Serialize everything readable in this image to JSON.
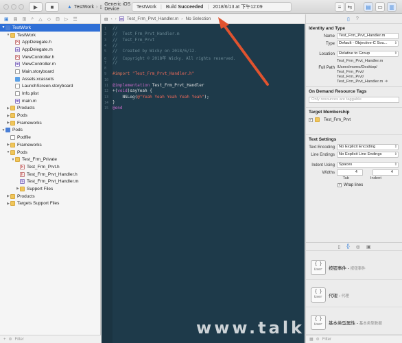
{
  "toolbar": {
    "scheme_label": "TestWork",
    "device_label": "Generic iOS Device",
    "status": {
      "project": "TestWork",
      "build_prefix": "Build",
      "build_result": "Succeeded",
      "timestamp": "2018/6/13 at 下午12:09"
    }
  },
  "navigator": {
    "filter_placeholder": "Filter",
    "items": [
      {
        "label": "TestWork",
        "kind": "proj",
        "depth": 0,
        "expanded": true,
        "selected": true
      },
      {
        "label": "TestWork",
        "kind": "folder",
        "depth": 1,
        "expanded": true
      },
      {
        "label": "AppDelegate.h",
        "kind": "h",
        "depth": 2
      },
      {
        "label": "AppDelegate.m",
        "kind": "m",
        "depth": 2
      },
      {
        "label": "ViewController.h",
        "kind": "h",
        "depth": 2
      },
      {
        "label": "ViewController.m",
        "kind": "m",
        "depth": 2
      },
      {
        "label": "Main.storyboard",
        "kind": "sb",
        "depth": 2
      },
      {
        "label": "Assets.xcassets",
        "kind": "xc",
        "depth": 2
      },
      {
        "label": "LaunchScreen.storyboard",
        "kind": "sb",
        "depth": 2
      },
      {
        "label": "Info.plist",
        "kind": "plist",
        "depth": 2
      },
      {
        "label": "main.m",
        "kind": "m",
        "depth": 2
      },
      {
        "label": "Products",
        "kind": "folder",
        "depth": 1,
        "expanded": false
      },
      {
        "label": "Pods",
        "kind": "folder",
        "depth": 1,
        "expanded": false
      },
      {
        "label": "Frameworks",
        "kind": "folder",
        "depth": 1,
        "expanded": false
      },
      {
        "label": "Pods",
        "kind": "proj",
        "depth": 0,
        "expanded": true
      },
      {
        "label": "Podfile",
        "kind": "plist",
        "depth": 1
      },
      {
        "label": "Frameworks",
        "kind": "folder",
        "depth": 1,
        "expanded": false
      },
      {
        "label": "Pods",
        "kind": "folder",
        "depth": 1,
        "expanded": true
      },
      {
        "label": "Test_Frm_Private",
        "kind": "folder",
        "depth": 2,
        "expanded": true
      },
      {
        "label": "Test_Frm_Prvt.h",
        "kind": "h",
        "depth": 3
      },
      {
        "label": "Test_Frm_Prvt_Handler.h",
        "kind": "h",
        "depth": 3
      },
      {
        "label": "Test_Frm_Prvt_Handler.m",
        "kind": "m",
        "depth": 3
      },
      {
        "label": "Support Files",
        "kind": "folder",
        "depth": 3,
        "expanded": false
      },
      {
        "label": "Products",
        "kind": "folder",
        "depth": 1,
        "expanded": false
      },
      {
        "label": "Targets Support Files",
        "kind": "folder",
        "depth": 1,
        "expanded": false
      }
    ]
  },
  "editor": {
    "jumpbar_file": "Test_Frm_Prvt_Handler.m",
    "jumpbar_selection": "No Selection",
    "lines": [
      {
        "n": "1",
        "segs": [
          {
            "c": "cmt",
            "t": "//"
          }
        ]
      },
      {
        "n": "2",
        "segs": [
          {
            "c": "cmt",
            "t": "//  Test_Frm_Prvt_Handler.m"
          }
        ]
      },
      {
        "n": "3",
        "segs": [
          {
            "c": "cmt",
            "t": "//  Test_Frm_Prvt"
          }
        ]
      },
      {
        "n": "4",
        "segs": [
          {
            "c": "cmt",
            "t": "//"
          }
        ]
      },
      {
        "n": "5",
        "segs": [
          {
            "c": "cmt",
            "t": "//  Created by Wicky on 2018/6/12."
          }
        ]
      },
      {
        "n": "6",
        "segs": [
          {
            "c": "cmt",
            "t": "//  Copyright © 2018年 Wicky. All rights reserved."
          }
        ]
      },
      {
        "n": "7",
        "segs": [
          {
            "c": "cmt",
            "t": "//"
          }
        ]
      },
      {
        "n": "8",
        "segs": []
      },
      {
        "n": "9",
        "segs": [
          {
            "c": "pp",
            "t": "#import "
          },
          {
            "c": "str",
            "t": "\"Test_Frm_Prvt_Handler.h\""
          }
        ]
      },
      {
        "n": "10",
        "segs": []
      },
      {
        "n": "11",
        "segs": [
          {
            "c": "kw",
            "t": "@implementation"
          },
          {
            "c": "pl",
            "t": " Test_Frm_Prvt_Handler"
          }
        ]
      },
      {
        "n": "12",
        "segs": [
          {
            "c": "pl",
            "t": "+("
          },
          {
            "c": "kw",
            "t": "void"
          },
          {
            "c": "pl",
            "t": ")sayYeah {"
          }
        ]
      },
      {
        "n": "13",
        "segs": [
          {
            "c": "pl",
            "t": "    NSLog("
          },
          {
            "c": "str",
            "t": "@\"Yeah Yeah Yeah Yeah Yeah\""
          },
          {
            "c": "pl",
            "t": ");"
          }
        ]
      },
      {
        "n": "14",
        "segs": [
          {
            "c": "pl",
            "t": "}"
          }
        ]
      },
      {
        "n": "15",
        "segs": [
          {
            "c": "kw",
            "t": "@end"
          }
        ]
      }
    ],
    "watermark": "www.talk"
  },
  "inspector": {
    "identity": {
      "title": "Identity and Type",
      "name_label": "Name",
      "name_value": "Test_Frm_Prvt_Handler.m",
      "type_label": "Type",
      "type_value": "Default - Objective-C Sou...",
      "location_label": "Location",
      "location_value": "Relative to Group",
      "location_file": "Test_Frm_Prvt_Handler.m",
      "fullpath_label": "Full Path",
      "fullpath_lines": [
        "/Users/momo/Desktop/",
        "Test_Frm_Prvt/",
        "Test_Frm_Prvt/",
        "Test_Frm_Prvt_Handler.m"
      ]
    },
    "ondemand": {
      "title": "On Demand Resource Tags",
      "placeholder": "Only resources are taggable"
    },
    "target": {
      "title": "Target Membership",
      "name": "Test_Frm_Prvt",
      "checked": true
    },
    "text_settings": {
      "title": "Text Settings",
      "encoding_label": "Text Encoding",
      "encoding_value": "No Explicit Encoding",
      "endings_label": "Line Endings",
      "endings_value": "No Explicit Line Endings",
      "indent_label": "Indent Using",
      "indent_value": "Spaces",
      "widths_label": "Widths",
      "tab_value": "4",
      "indent_width_value": "4",
      "tab_caption": "Tab",
      "indent_caption": "Indent",
      "wrap_label": "Wrap lines",
      "wrap_checked": true
    },
    "library": [
      {
        "icon_top": "{ }",
        "icon_sub": "User",
        "title": "按钮事件",
        "sub": "按钮事件"
      },
      {
        "icon_top": "{ }",
        "icon_sub": "User",
        "title": "代理",
        "sub": "代理"
      },
      {
        "icon_top": "{ }",
        "icon_sub": "User",
        "title": "基本类型属性",
        "sub": "基本类型数据"
      }
    ],
    "filter_placeholder": "Filter"
  },
  "colors": {
    "editor_bg": "#1e3a4a",
    "selection": "#2f6fd6",
    "arrow": "#e0532f"
  }
}
